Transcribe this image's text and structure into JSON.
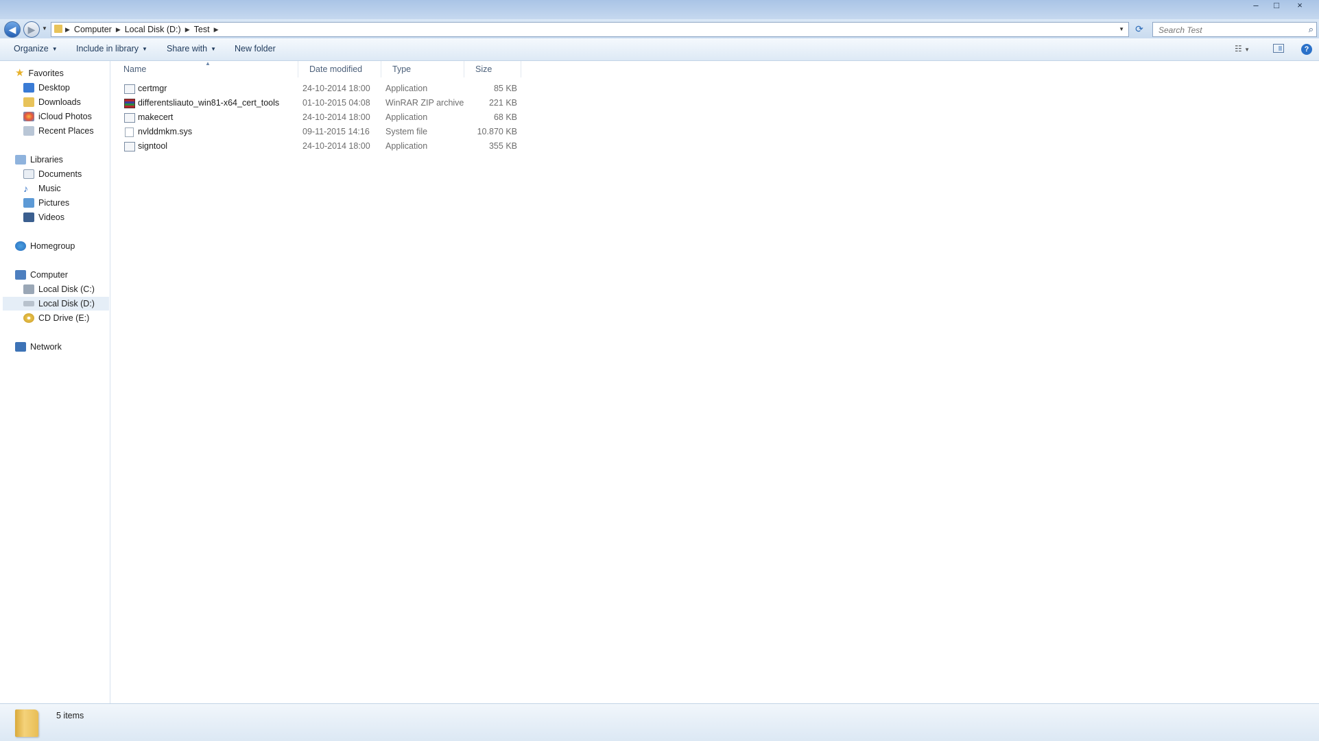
{
  "window": {
    "minimize_label": "–",
    "maximize_label": "□",
    "close_label": "×"
  },
  "address": {
    "path": [
      "Computer",
      "Local Disk (D:)",
      "Test"
    ]
  },
  "search": {
    "placeholder": "Search Test"
  },
  "toolbar": {
    "organize": "Organize",
    "include_in_library": "Include in library",
    "share_with": "Share with",
    "new_folder": "New folder",
    "help": "?"
  },
  "sidebar": {
    "favorites": {
      "label": "Favorites",
      "items": [
        "Desktop",
        "Downloads",
        "iCloud Photos",
        "Recent Places"
      ]
    },
    "libraries": {
      "label": "Libraries",
      "items": [
        "Documents",
        "Music",
        "Pictures",
        "Videos"
      ]
    },
    "homegroup": {
      "label": "Homegroup"
    },
    "computer": {
      "label": "Computer",
      "items": [
        "Local Disk (C:)",
        "Local Disk (D:)",
        "CD Drive (E:)"
      ],
      "selected": "Local Disk (D:)"
    },
    "network": {
      "label": "Network"
    }
  },
  "columns": {
    "name": "Name",
    "date_modified": "Date modified",
    "type": "Type",
    "size": "Size"
  },
  "files": [
    {
      "name": "certmgr",
      "date": "24-10-2014 18:00",
      "type": "Application",
      "size": "85 KB",
      "icon": "application-icon"
    },
    {
      "name": "differentsliauto_win81-x64_cert_tools",
      "date": "01-10-2015 04:08",
      "type": "WinRAR ZIP archive",
      "size": "221 KB",
      "icon": "winrar-archive-icon"
    },
    {
      "name": "makecert",
      "date": "24-10-2014 18:00",
      "type": "Application",
      "size": "68 KB",
      "icon": "application-icon"
    },
    {
      "name": "nvlddmkm.sys",
      "date": "09-11-2015 14:16",
      "type": "System file",
      "size": "10.870 KB",
      "icon": "system-file-icon"
    },
    {
      "name": "signtool",
      "date": "24-10-2014 18:00",
      "type": "Application",
      "size": "355 KB",
      "icon": "application-icon"
    }
  ],
  "status": {
    "item_count": "5 items"
  }
}
